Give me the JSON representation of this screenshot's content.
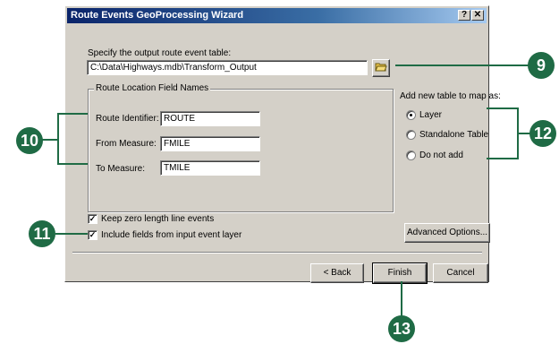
{
  "window": {
    "title": "Route Events GeoProcessing Wizard",
    "help_label": "?",
    "close_label": "✕"
  },
  "output": {
    "label": "Specify the output route event table:",
    "path_value": "C:\\Data\\Highways.mdb\\Transform_Output"
  },
  "route_group": {
    "title": "Route Location Field Names",
    "route_identifier_label": "Route Identifier:",
    "route_identifier_value": "ROUTE",
    "from_measure_label": "From Measure:",
    "from_measure_value": "FMILE",
    "to_measure_label": "To Measure:",
    "to_measure_value": "TMILE"
  },
  "add_table": {
    "label": "Add new table to map as:",
    "options": [
      "Layer",
      "Standalone Table",
      "Do not add"
    ],
    "selected": "Layer"
  },
  "checkboxes": {
    "keep_zero_length": "Keep  zero length line events",
    "include_fields": "Include fields from input event layer"
  },
  "buttons": {
    "advanced": "Advanced Options...",
    "back": "< Back",
    "finish": "Finish",
    "cancel": "Cancel"
  },
  "callouts": {
    "c9": "9",
    "c10": "10",
    "c11": "11",
    "c12": "12",
    "c13": "13"
  },
  "colors": {
    "callout": "#1f6b45",
    "title_bar": "#0a246a",
    "dialog_face": "#d4d0c8"
  }
}
